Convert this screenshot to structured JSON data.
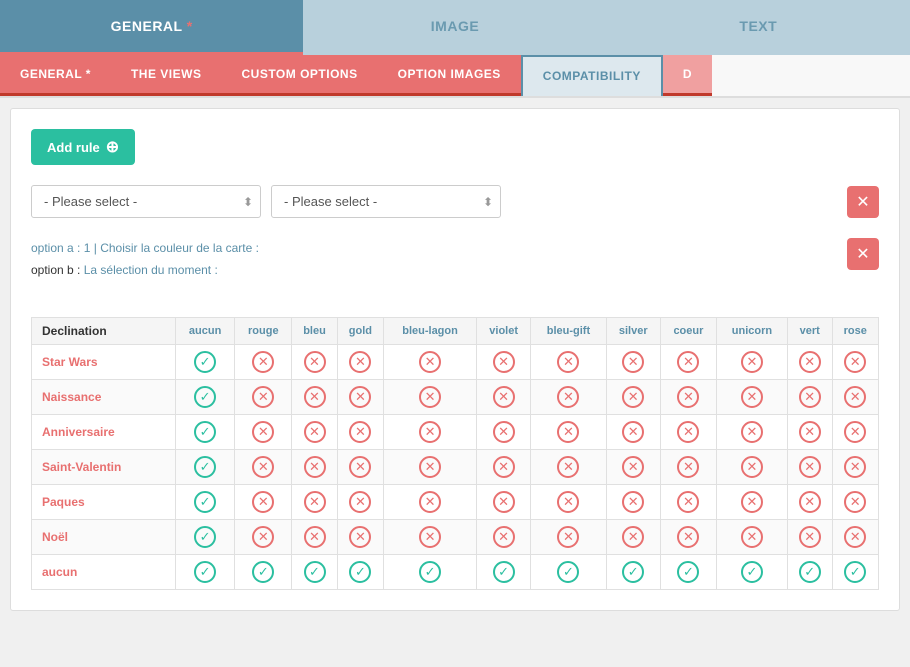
{
  "topTabs": [
    {
      "id": "general",
      "label": "GENERAL",
      "hasAsterisk": true,
      "state": "active"
    },
    {
      "id": "image",
      "label": "IMAGE",
      "hasAsterisk": false,
      "state": "inactive"
    },
    {
      "id": "text",
      "label": "TEXT",
      "hasAsterisk": false,
      "state": "inactive"
    }
  ],
  "subTabs": [
    {
      "id": "general",
      "label": "GENERAL",
      "hasAsterisk": true,
      "state": "active"
    },
    {
      "id": "theviews",
      "label": "THE VIEWS",
      "hasAsterisk": false,
      "state": "active"
    },
    {
      "id": "customoptions",
      "label": "CUSTOM OPTIONS",
      "hasAsterisk": false,
      "state": "active"
    },
    {
      "id": "optionimages",
      "label": "OPTION IMAGES",
      "hasAsterisk": false,
      "state": "active"
    },
    {
      "id": "compatibility",
      "label": "COMPATIBILITY",
      "hasAsterisk": false,
      "state": "selected"
    },
    {
      "id": "d",
      "label": "D",
      "hasAsterisk": false,
      "state": "active"
    }
  ],
  "addRuleButton": {
    "label": "Add rule",
    "icon": "+"
  },
  "selects": {
    "first": {
      "placeholder": "- Please select -"
    },
    "second": {
      "placeholder": "- Please select -"
    }
  },
  "infoSection": {
    "optionA": "option a : 1",
    "separator1": " | ",
    "chooseLabel": "Choisir la couleur de la carte :",
    "optionB": "option b :",
    "selectionLabel": "La sélection du moment :"
  },
  "table": {
    "firstColumnHeader": "Declination",
    "columnHeaders": [
      "aucun",
      "rouge",
      "bleu",
      "gold",
      "bleu-lagon",
      "violet",
      "bleu-gift",
      "silver",
      "coeur",
      "unicorn",
      "vert",
      "rose"
    ],
    "rows": [
      {
        "label": "Star Wars",
        "values": [
          "check",
          "cross",
          "cross",
          "cross",
          "cross",
          "cross",
          "cross",
          "cross",
          "cross",
          "cross",
          "cross",
          "cross"
        ]
      },
      {
        "label": "Naissance",
        "values": [
          "check",
          "cross",
          "cross",
          "cross",
          "cross",
          "cross",
          "cross",
          "cross",
          "cross",
          "cross",
          "cross",
          "cross"
        ]
      },
      {
        "label": "Anniversaire",
        "values": [
          "check",
          "cross",
          "cross",
          "cross",
          "cross",
          "cross",
          "cross",
          "cross",
          "cross",
          "cross",
          "cross",
          "cross"
        ]
      },
      {
        "label": "Saint-Valentin",
        "values": [
          "check",
          "cross",
          "cross",
          "cross",
          "cross",
          "cross",
          "cross",
          "cross",
          "cross",
          "cross",
          "cross",
          "cross"
        ]
      },
      {
        "label": "Paques",
        "values": [
          "check",
          "cross",
          "cross",
          "cross",
          "cross",
          "cross",
          "cross",
          "cross",
          "cross",
          "cross",
          "cross",
          "cross"
        ]
      },
      {
        "label": "Noël",
        "values": [
          "check",
          "cross",
          "cross",
          "cross",
          "cross",
          "cross",
          "cross",
          "cross",
          "cross",
          "cross",
          "cross",
          "cross"
        ]
      },
      {
        "label": "aucun",
        "values": [
          "check",
          "check",
          "check",
          "check",
          "check",
          "check",
          "check",
          "check",
          "check",
          "check",
          "check",
          "check"
        ]
      }
    ]
  }
}
